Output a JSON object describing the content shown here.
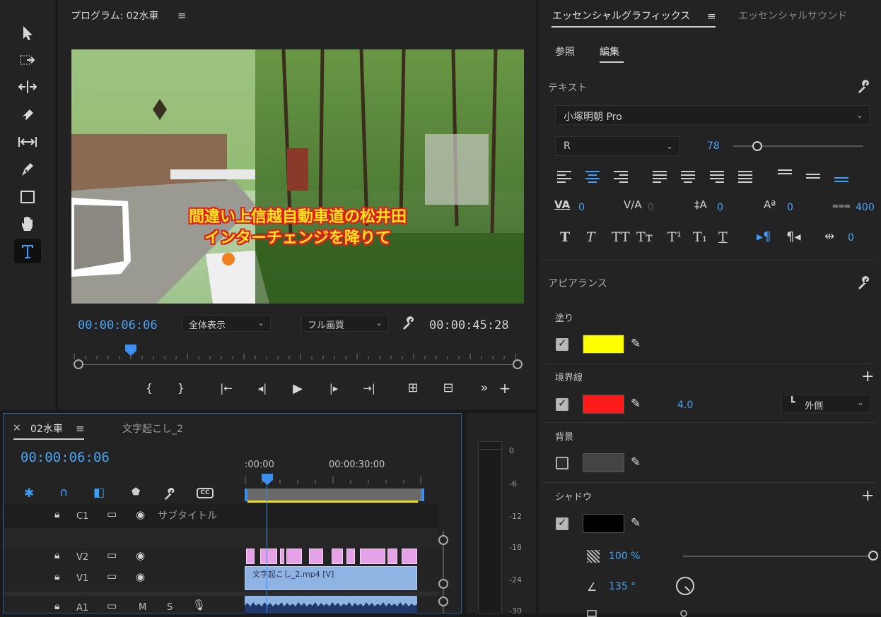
{
  "toolbar": {
    "tools": [
      "selection",
      "track-select",
      "ripple-edit",
      "razor",
      "slip",
      "pen",
      "rectangle",
      "hand",
      "type"
    ]
  },
  "program": {
    "title": "プログラム: 02水車",
    "menu_glyph": "≡",
    "subtitle_line1": "間違い上信越自動車道の松井田",
    "subtitle_line2": "インターチェンジを降りて",
    "current_tc": "00:00:06:06",
    "zoom": "全体表示",
    "quality": "フル画質",
    "duration_tc": "00:00:45:28",
    "controls": [
      "{",
      "}",
      "|←",
      "◂|",
      "▶",
      "|▸",
      "→|",
      "⊞",
      "⊟",
      "»",
      "+"
    ]
  },
  "timeline": {
    "close_glyph": "×",
    "tab_active": "02水車",
    "tab_other": "文字起こし_2",
    "current_tc": "00:00:06:06",
    "ruler_start": ":00:00",
    "ruler_mid": "00:00:30:00",
    "tracks": {
      "c1": "C1",
      "subtitle": "サブタイトル",
      "v2": "V2",
      "v1": "V1",
      "a1": "A1",
      "m": "M",
      "s": "S"
    },
    "clip_v1": "文字起こし_2.mp4 [V]"
  },
  "meter": {
    "ticks": [
      "0",
      "-6",
      "-12",
      "-18",
      "-24",
      "-30"
    ]
  },
  "essential": {
    "tab_graphics": "エッセンシャルグラフィックス",
    "tab_sound": "エッセンシャルサウンド",
    "subtab_browse": "参照",
    "subtab_edit": "編集",
    "text_section": "テキスト",
    "font": "小塚明朝 Pro",
    "style": "R",
    "size": "78",
    "kerning": "0",
    "tracking": "0",
    "leading": "0",
    "baseline": "0",
    "tsume": "400",
    "tsume_extra": "0",
    "appearance": "アピアランス",
    "fill_label": "塗り",
    "fill_color": "#ffff00",
    "stroke_label": "境界線",
    "stroke_color": "#ff1a1a",
    "stroke_width": "4.0",
    "stroke_position": "外側",
    "bg_label": "背景",
    "bg_color": "#444444",
    "shadow_label": "シャドウ",
    "shadow_color": "#000000",
    "opacity": "100 %",
    "angle": "135 °"
  },
  "accent": "#4aa3f5"
}
